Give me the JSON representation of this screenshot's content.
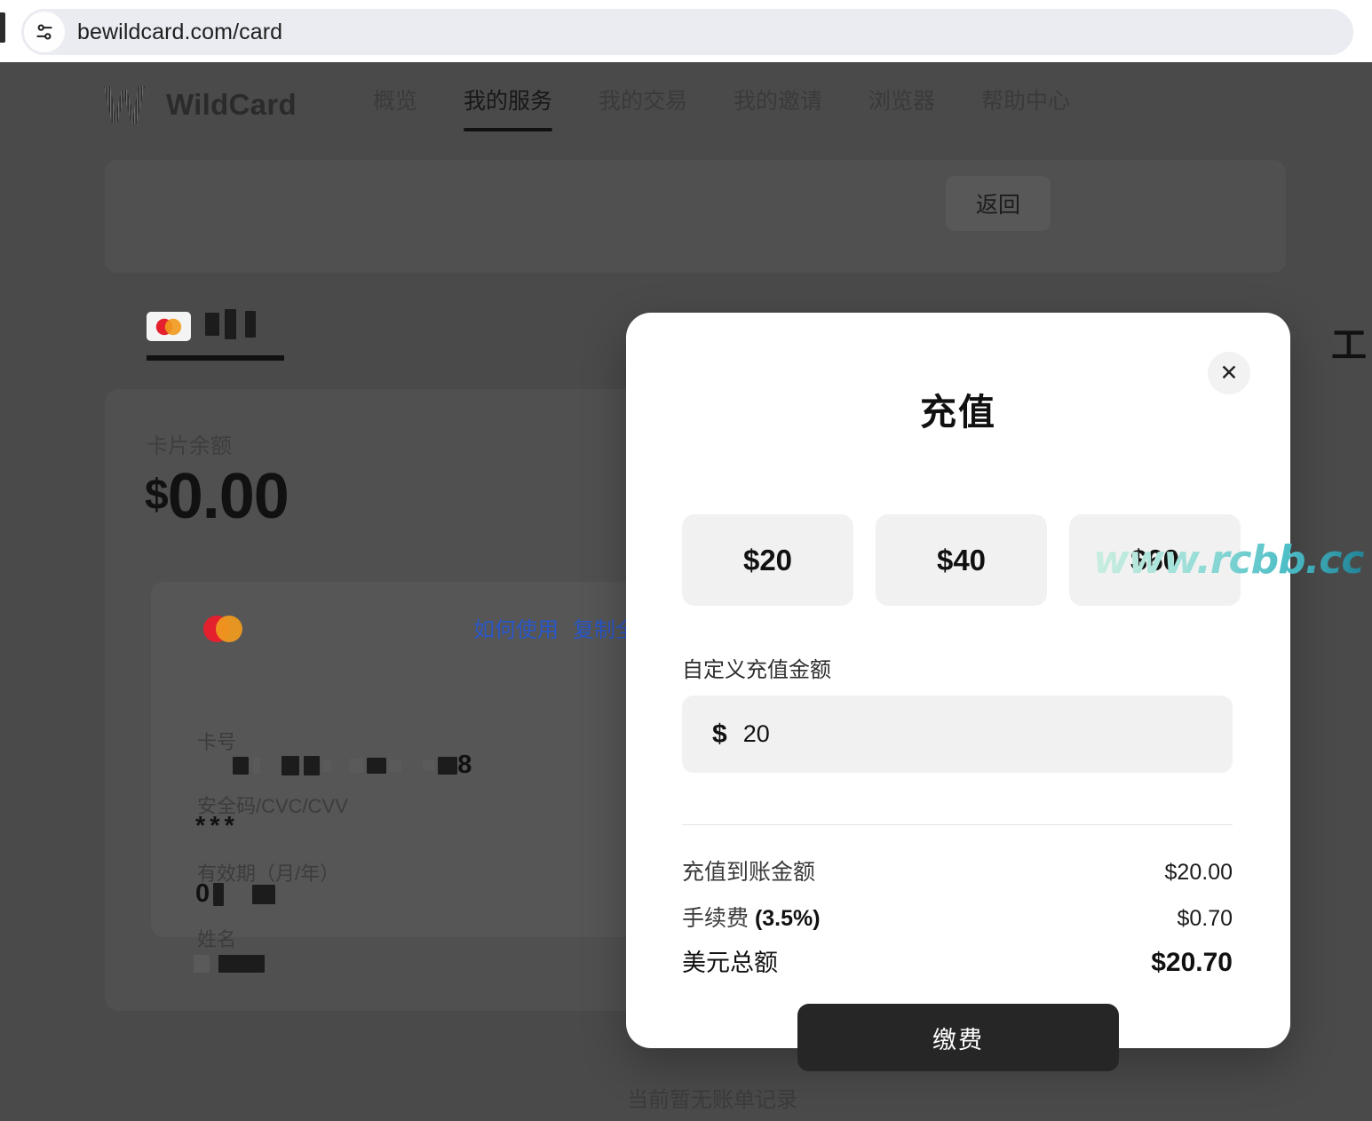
{
  "browser": {
    "url": "bewildcard.com/card",
    "site_settings_icon": "site-settings-icon"
  },
  "nav": {
    "brand": "WildCard",
    "links": [
      {
        "label": "概览",
        "active": false
      },
      {
        "label": "我的服务",
        "active": true
      },
      {
        "label": "我的交易",
        "active": false
      },
      {
        "label": "我的邀请",
        "active": false
      },
      {
        "label": "浏览器",
        "active": false
      },
      {
        "label": "帮助中心",
        "active": false
      }
    ]
  },
  "page": {
    "back_button": "返回",
    "card_tab_label": "754",
    "balance_label": "卡片余额",
    "balance_value": "0.00",
    "balance_currency": "$",
    "card_links": [
      "如何使用",
      "复制全部"
    ],
    "fields": [
      {
        "label": "卡号",
        "value": "8"
      },
      {
        "label": "安全码/CVC/CVV",
        "value": "***"
      },
      {
        "label": "有效期（月/年）",
        "value": "0"
      },
      {
        "label": "姓名",
        "value": ""
      }
    ],
    "no_records": "当前暂无账单记录",
    "right_stub": "工"
  },
  "modal": {
    "title": "充值",
    "close_label": "✕",
    "quick_amounts": [
      "$20",
      "$40",
      "$60"
    ],
    "custom_label": "自定义充值金额",
    "currency_symbol": "$",
    "custom_amount_value": "20",
    "custom_amount_placeholder": "0",
    "summary": [
      {
        "label": "充值到账金额",
        "amount": "$20.00"
      },
      {
        "label": "手续费 ",
        "label_bold": "(3.5%)",
        "amount": "$0.70"
      },
      {
        "label": "美元总额",
        "amount": "$20.70"
      }
    ],
    "submit_label": "缴费"
  },
  "watermark": {
    "text": "www.rcbb.cc"
  },
  "colors": {
    "page_background": "#4a4a4a",
    "modal_background": "#ffffff",
    "accent_dark": "#262626",
    "quick_amount_bg": "#f1f1f1",
    "link_blue": "#2856c8",
    "omnibox_bg": "#eaecf1"
  }
}
